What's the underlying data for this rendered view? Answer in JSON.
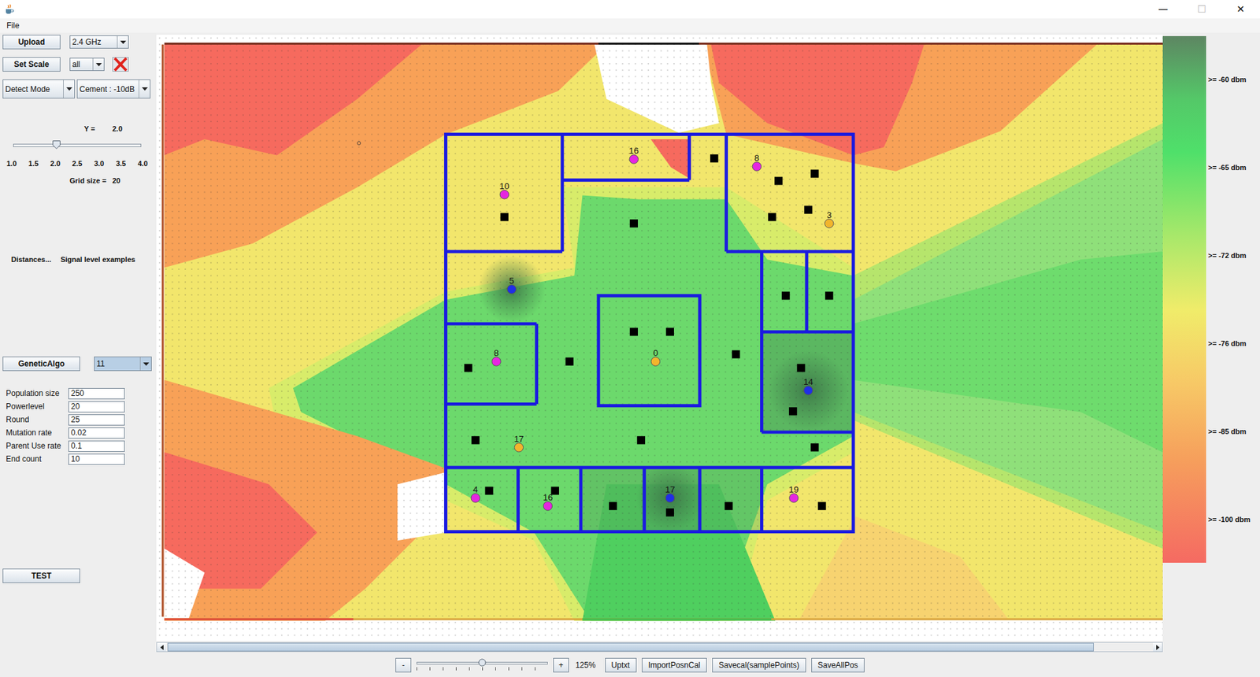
{
  "window": {
    "controls": [
      {
        "glyph": "—",
        "disabled": false
      },
      {
        "glyph": "☐",
        "disabled": true
      },
      {
        "glyph": "✕",
        "disabled": false
      }
    ]
  },
  "menu": [
    {
      "label": "File"
    }
  ],
  "left_panel": {
    "upload_button": "Upload",
    "band_select": "2.4 GHz",
    "set_scale_button": "Set Scale",
    "scale_select": "all",
    "detect_mode_select": "Detect Mode",
    "material_select": "Cement : -10dB",
    "y_label": "Y =",
    "y_value": "2.0",
    "y_slider": {
      "level": 0.34,
      "ticks": [
        "1.0",
        "1.5",
        "2.0",
        "2.5",
        "3.0",
        "3.5",
        "4.0"
      ]
    },
    "grid_label": "Grid size =",
    "grid_value": "20",
    "links": [
      "Distances...",
      "Signal level examples"
    ],
    "algo_button": "GeneticAlgo",
    "algo_select": "11",
    "params": [
      {
        "label": "Population size",
        "value": "250"
      },
      {
        "label": "Powerlevel",
        "value": "20"
      },
      {
        "label": "Round",
        "value": "25"
      },
      {
        "label": "Mutation rate",
        "value": "0.02"
      },
      {
        "label": "Parent Use rate",
        "value": "0.1"
      },
      {
        "label": "End count",
        "value": "10"
      }
    ],
    "test_button": "TEST"
  },
  "map": {
    "access_points": [
      {
        "label": "16",
        "color": "#e626e0"
      },
      {
        "label": "8",
        "color": "#e626e0"
      },
      {
        "label": "10",
        "color": "#e626e0"
      },
      {
        "label": "3",
        "color": "#f2b52c"
      },
      {
        "label": "5",
        "color": "#1f2fe6"
      },
      {
        "label": "8",
        "color": "#e626e0"
      },
      {
        "label": "0",
        "color": "#f2b52c"
      },
      {
        "label": "14",
        "color": "#1f2fe6"
      },
      {
        "label": "17",
        "color": "#f2b52c"
      },
      {
        "label": "4",
        "color": "#e626e0"
      },
      {
        "label": "16",
        "color": "#e626e0"
      },
      {
        "label": "17",
        "color": "#1f2fe6"
      },
      {
        "label": "19",
        "color": "#e626e0"
      }
    ]
  },
  "legend": [
    ">= -60 dbm",
    ">= -65 dbm",
    ">= -72 dbm",
    ">= -76 dbm",
    ">= -85 dbm",
    ">= -100 dbm"
  ],
  "h_scroll": {
    "level": 0.94
  },
  "zoom": {
    "minus": "-",
    "plus": "+",
    "level": 0.5,
    "reading": "125%"
  },
  "toolbar_buttons": [
    "Uptxt",
    "ImportPosnCal",
    "Savecal(samplePoints)",
    "SaveAllPos"
  ]
}
